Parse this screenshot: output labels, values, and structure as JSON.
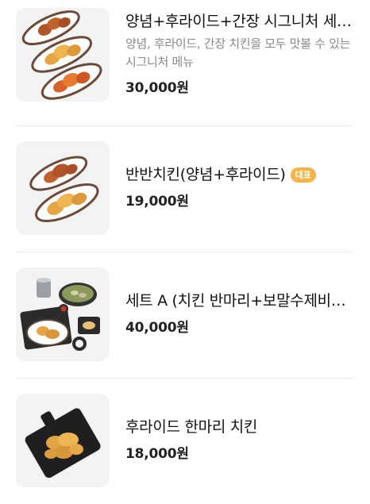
{
  "menu": {
    "items": [
      {
        "name": "양념+후라이드+간장 시그니처 세…",
        "description": "양념, 후라이드, 간장 치킨을 모두 맛볼 수 있는 시그니처 메뉴",
        "price": "30,000원",
        "image_icon": "chicken-three-plates-icon"
      },
      {
        "name": "반반치킨(양념+후라이드)",
        "badge": "대표",
        "price": "19,000원",
        "image_icon": "chicken-two-plates-icon"
      },
      {
        "name": "세트 A (치킨 반마리+보말수제비…",
        "price": "40,000원",
        "image_icon": "chicken-set-icon"
      },
      {
        "name": "후라이드 한마리 치킨",
        "price": "18,000원",
        "image_icon": "fried-chicken-board-icon"
      }
    ]
  },
  "colors": {
    "badge": "#f7b347",
    "price": "#222222",
    "description": "#888888",
    "thumb_bg": "#f3f3f3"
  }
}
